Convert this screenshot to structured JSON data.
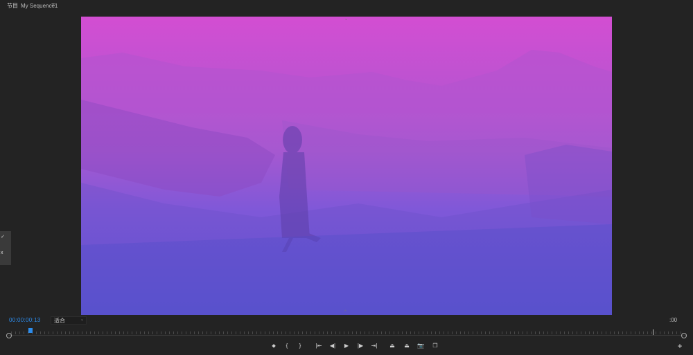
{
  "panel": {
    "title": "节目",
    "sequence": "My Sequence1",
    "menu_glyph": "≡"
  },
  "side_tab": {
    "glyph_top": "✓",
    "glyph_bottom": "x"
  },
  "viewer": {
    "timecode": "00:00:00:13",
    "zoom": {
      "selected": "适合",
      "arrow": "⌄"
    },
    "end_time": ":00",
    "playhead_position": 0.03
  },
  "colors": {
    "accent": "#2d8ceb",
    "panel_bg": "#232323",
    "video_top": "#d34ed2",
    "video_bottom": "#5756d2"
  },
  "controls": [
    {
      "name": "add-marker-button",
      "icon": "marker-icon",
      "glyph": "⬥"
    },
    {
      "name": "mark-in-button",
      "icon": "mark-in-icon",
      "glyph": "{"
    },
    {
      "name": "mark-out-button",
      "icon": "mark-out-icon",
      "glyph": "}"
    },
    {
      "name": "go-to-in-button",
      "icon": "go-to-in-icon",
      "glyph": "|⇤"
    },
    {
      "name": "step-back-button",
      "icon": "step-back-icon",
      "glyph": "◀|"
    },
    {
      "name": "play-button",
      "icon": "play-icon",
      "glyph": "▶"
    },
    {
      "name": "step-forward-button",
      "icon": "step-forward-icon",
      "glyph": "|▶"
    },
    {
      "name": "go-to-out-button",
      "icon": "go-to-out-icon",
      "glyph": "⇥|"
    },
    {
      "name": "lift-button",
      "icon": "lift-icon",
      "glyph": "⏏"
    },
    {
      "name": "extract-button",
      "icon": "extract-icon",
      "glyph": "⏏"
    },
    {
      "name": "export-frame-button",
      "icon": "camera-icon",
      "glyph": "📷"
    },
    {
      "name": "comparison-view-button",
      "icon": "comparison-icon",
      "glyph": "❐"
    }
  ],
  "add_button": {
    "glyph": "+"
  }
}
